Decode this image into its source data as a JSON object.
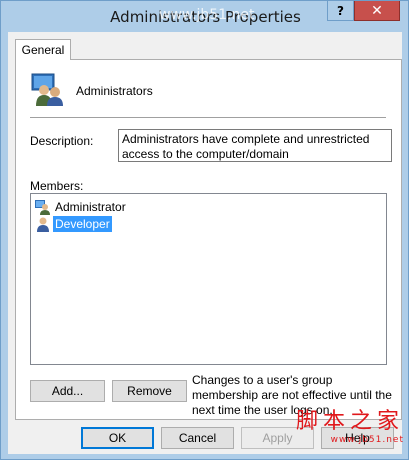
{
  "window": {
    "title": "Administrators Properties",
    "help_label": "?",
    "close_label": "✕"
  },
  "tabs": [
    {
      "label": "General",
      "selected": true
    }
  ],
  "group": {
    "icon": "group-users-icon",
    "name": "Administrators"
  },
  "description": {
    "label": "Description:",
    "value": "Administrators have complete and unrestricted access to the computer/domain"
  },
  "members": {
    "label": "Members:",
    "items": [
      {
        "name": "Administrator",
        "icon": "user-icon",
        "selected": false
      },
      {
        "name": "Developer",
        "icon": "user-icon",
        "selected": true
      }
    ]
  },
  "buttons": {
    "add": "Add...",
    "remove": "Remove",
    "ok": "OK",
    "cancel": "Cancel",
    "apply": "Apply",
    "help": "Help"
  },
  "note": "Changes to a user's group membership are not effective until the next time the user logs on.",
  "watermark": {
    "text": "脚本之家",
    "url": "www.jb51.net",
    "overlay": "www.jb51.net"
  },
  "colors": {
    "selection": "#3399ff",
    "close": "#c7504c",
    "watermark": "#e0181c"
  }
}
